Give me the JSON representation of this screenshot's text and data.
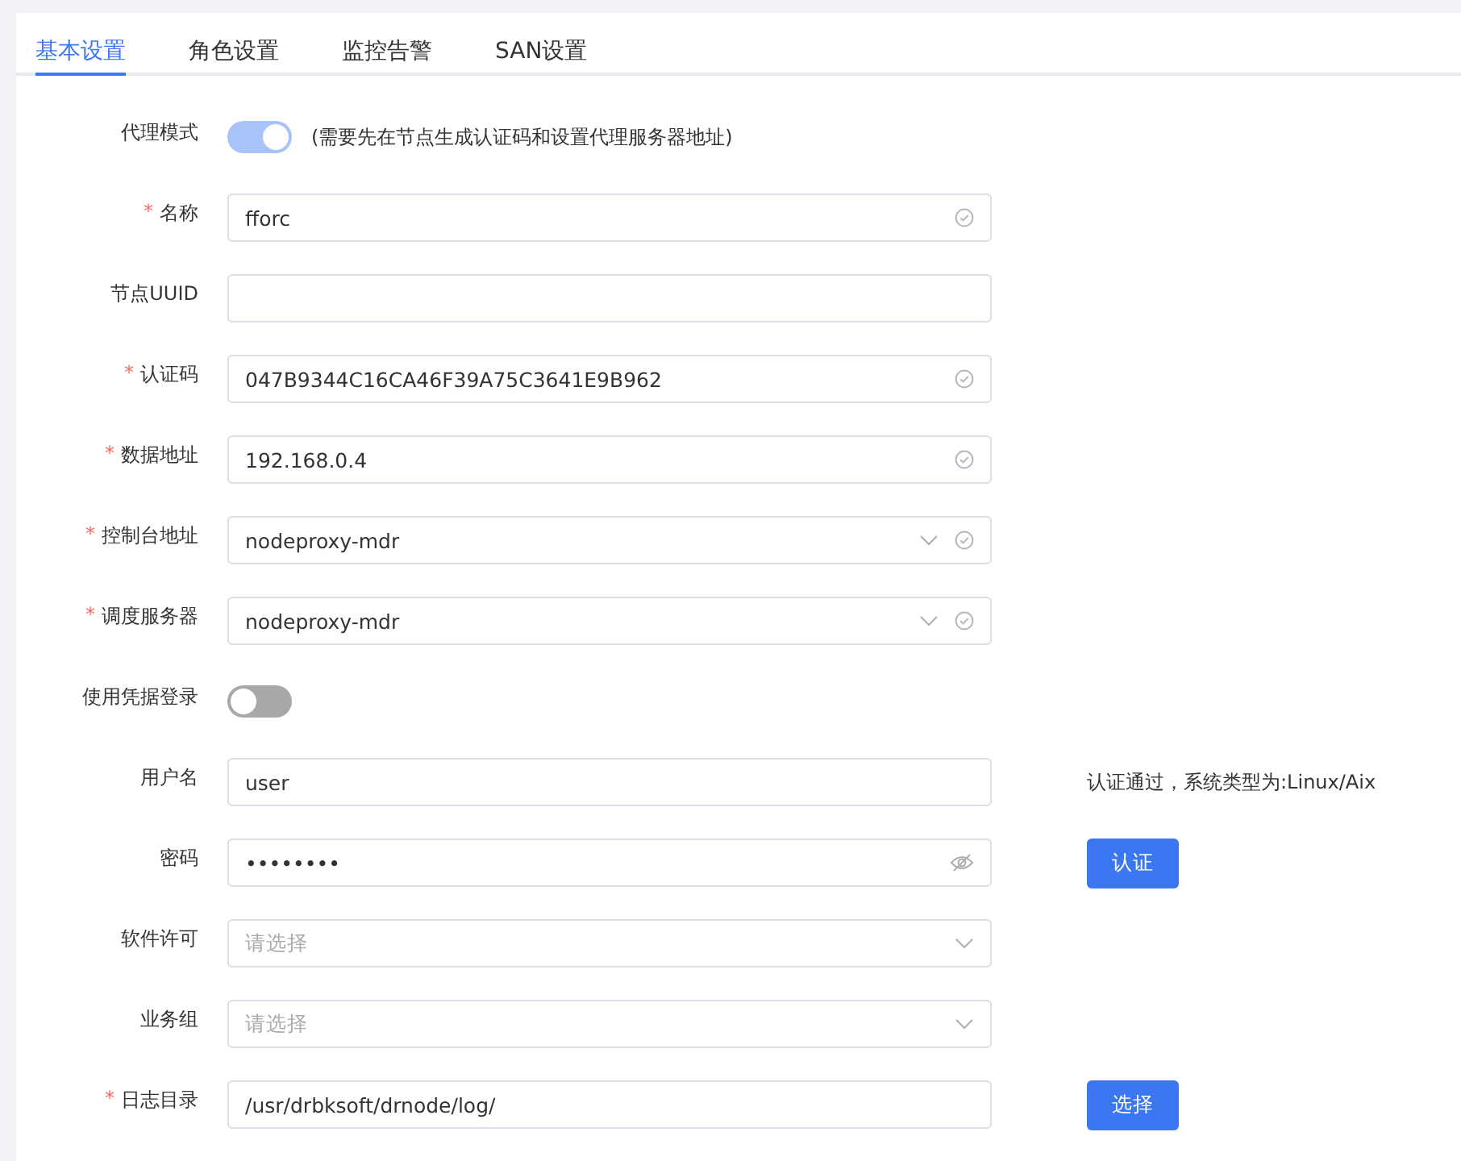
{
  "tabs": [
    {
      "label": "基本设置",
      "selected": true
    },
    {
      "label": "角色设置",
      "selected": false
    },
    {
      "label": "监控告警",
      "selected": false
    },
    {
      "label": "SAN设置",
      "selected": false
    }
  ],
  "form": [
    {
      "kind": "switch",
      "label": "代理模式",
      "on": true,
      "hint": "(需要先在节点生成认证码和设置代理服务器地址)"
    },
    {
      "kind": "text",
      "label": "名称",
      "required_mark": "*",
      "value": "fforc",
      "valid": true
    },
    {
      "kind": "text",
      "label": "节点UUID",
      "valid": false
    },
    {
      "kind": "text",
      "label": "认证码",
      "required_mark": "*",
      "value": "047B9344C16CA46F39A75C3641E9B962",
      "valid": true
    },
    {
      "kind": "text",
      "label": "数据地址",
      "required_mark": "*",
      "value": "192.168.0.4",
      "valid": true
    },
    {
      "kind": "select",
      "label": "控制台地址",
      "required_mark": "*",
      "value": "nodeproxy-mdr",
      "valid": true
    },
    {
      "kind": "select",
      "label": "调度服务器",
      "required_mark": "*",
      "value": "nodeproxy-mdr",
      "valid": true
    },
    {
      "kind": "switch",
      "label": "使用凭据登录",
      "on": false
    },
    {
      "kind": "text",
      "label": "用户名",
      "value": "user",
      "valid": false,
      "side_text": "认证通过，系统类型为:Linux/Aix"
    },
    {
      "kind": "password",
      "label": "密码",
      "value": "••••••••",
      "valid": false,
      "button": "认证"
    },
    {
      "kind": "select",
      "label": "软件许可",
      "placeholder": "请选择",
      "valid": false
    },
    {
      "kind": "select",
      "label": "业务组",
      "placeholder": "请选择",
      "valid": false
    },
    {
      "kind": "text",
      "label": "日志目录",
      "required_mark": "*",
      "value": "/usr/drbksoft/drnode/log/",
      "valid": false,
      "button": "选择"
    }
  ]
}
